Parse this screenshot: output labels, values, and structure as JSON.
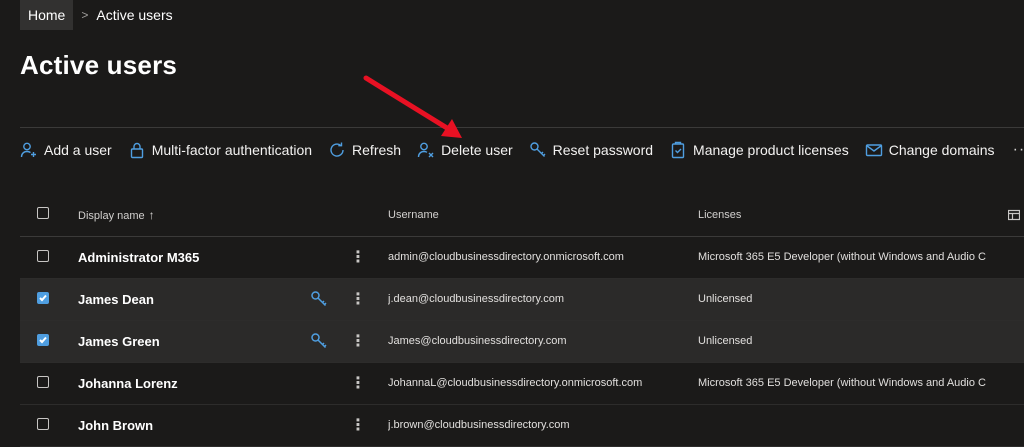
{
  "breadcrumb": {
    "home": "Home",
    "separator": ">",
    "current": "Active users"
  },
  "title": "Active users",
  "toolbar": [
    {
      "label": "Add a user",
      "icon": "add-user-icon"
    },
    {
      "label": "Multi-factor authentication",
      "icon": "lock-icon"
    },
    {
      "label": "Refresh",
      "icon": "refresh-icon"
    },
    {
      "label": "Delete user",
      "icon": "delete-user-icon"
    },
    {
      "label": "Reset password",
      "icon": "key-icon"
    },
    {
      "label": "Manage product licenses",
      "icon": "clipboard-icon"
    },
    {
      "label": "Change domains",
      "icon": "mail-icon"
    }
  ],
  "toolbar_more": "···",
  "table": {
    "columns": {
      "display_name": "Display name",
      "sort_indicator": "↑",
      "username": "Username",
      "licenses": "Licenses"
    },
    "rows": [
      {
        "name": "Administrator M365",
        "username": "admin@cloudbusinessdirectory.onmicrosoft.com",
        "license": "Microsoft 365 E5 Developer (without Windows and Audio C",
        "selected": false,
        "key": false
      },
      {
        "name": "James Dean",
        "username": "j.dean@cloudbusinessdirectory.com",
        "license": "Unlicensed",
        "selected": true,
        "key": true
      },
      {
        "name": "James Green",
        "username": "James@cloudbusinessdirectory.com",
        "license": "Unlicensed",
        "selected": true,
        "key": true
      },
      {
        "name": "Johanna Lorenz",
        "username": "JohannaL@cloudbusinessdirectory.onmicrosoft.com",
        "license": "Microsoft 365 E5 Developer (without Windows and Audio C",
        "selected": false,
        "key": false
      },
      {
        "name": "John Brown",
        "username": "j.brown@cloudbusinessdirectory.com",
        "license": "",
        "selected": false,
        "key": false
      }
    ],
    "kebab": "⋮"
  },
  "colors": {
    "background": "#1b1a19",
    "accent": "#4f9ee0",
    "arrow": "#e81123"
  }
}
